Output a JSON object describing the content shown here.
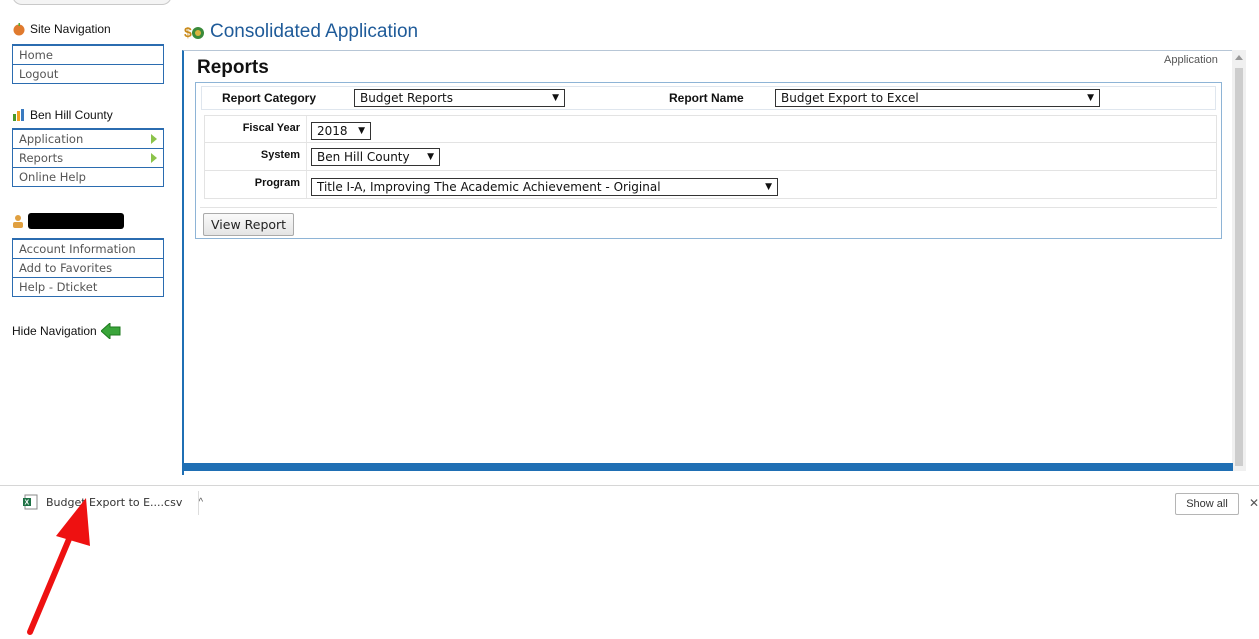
{
  "sidebar": {
    "site_nav": {
      "title": "Site Navigation",
      "items": [
        {
          "label": "Home"
        },
        {
          "label": "Logout"
        }
      ]
    },
    "district": {
      "title": "Ben Hill County",
      "items": [
        {
          "label": "Application"
        },
        {
          "label": "Reports"
        },
        {
          "label": "Online Help"
        }
      ]
    },
    "user": {
      "items": [
        {
          "label": "Account Information"
        },
        {
          "label": "Add to Favorites"
        },
        {
          "label": "Help - Dticket"
        }
      ]
    },
    "hide_nav": "Hide Navigation"
  },
  "header": {
    "app_title": "Consolidated Application",
    "corner_label": "Application"
  },
  "page": {
    "title": "Reports",
    "report_category_label": "Report Category",
    "report_category_value": "Budget Reports",
    "report_name_label": "Report Name",
    "report_name_value": "Budget Export to Excel",
    "params": [
      {
        "label": "Fiscal Year",
        "value": "2018"
      },
      {
        "label": "System",
        "value": "Ben Hill County"
      },
      {
        "label": "Program",
        "value": "Title I-A, Improving The Academic Achievement - Original"
      }
    ],
    "view_report_label": "View Report"
  },
  "download_bar": {
    "file_name": "Budget Export to E....csv",
    "show_all": "Show all"
  },
  "colors": {
    "accent_blue": "#1f6fb4",
    "nav_arrow_green": "#8bc34a",
    "annotation_red": "#ee1111"
  }
}
